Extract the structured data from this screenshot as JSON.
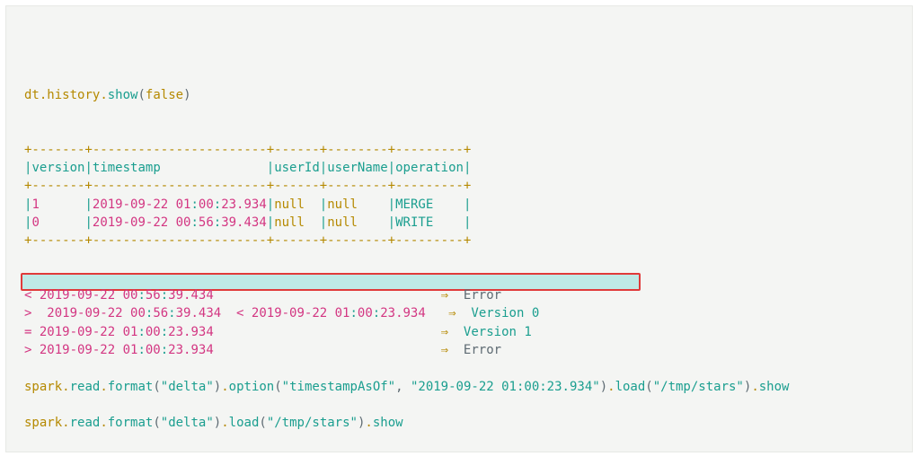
{
  "cmd1": {
    "obj": "dt",
    "d1": ".",
    "prop": "history",
    "d2": ".",
    "fn": "show",
    "lp": "(",
    "arg": "false",
    "rp": ")"
  },
  "table": {
    "rule1": "+-------+-----------------------+------+--------+---------+",
    "hdr": {
      "p0": "|",
      "c0": "version",
      "p1": "|",
      "c1": "timestamp              ",
      "p2": "|",
      "c2": "userId",
      "p3": "|",
      "c3": "userName",
      "p4": "|",
      "c4": "operation",
      "p5": "|"
    },
    "rule2": "+-------+-----------------------+------+--------+---------+",
    "row1": {
      "p0": "|",
      "v": "1      ",
      "p1": "|",
      "ts_a": "2019-09-22 01",
      "colon1": ":",
      "ts_b": "00",
      "colon2": ":",
      "ts_c": "23.934",
      "p2": "|",
      "uid": "null  ",
      "p3": "|",
      "un": "null    ",
      "p4": "|",
      "op": "MERGE    ",
      "p5": "|"
    },
    "row2": {
      "p0": "|",
      "v": "0      ",
      "p1": "|",
      "ts_a": "2019-09-22 00",
      "colon1": ":",
      "ts_b": "56",
      "colon2": ":",
      "ts_c": "39.434",
      "p2": "|",
      "uid": "null  ",
      "p3": "|",
      "un": "null    ",
      "p4": "|",
      "op": "WRITE    ",
      "p5": "|"
    },
    "rule3": "+-------+-----------------------+------+--------+---------+"
  },
  "cmp": {
    "l1": {
      "sym": "< ",
      "ts_a": "2019-09-22 00",
      "c1": ":",
      "ts_b": "56",
      "c2": ":",
      "ts_c": "39.434",
      "pad": "                              ",
      "arr": "⇒",
      "sp": "  ",
      "r": "Error"
    },
    "l2": {
      "sym": "> ",
      "sp0": " ",
      "ts_a": "2019-09-22 00",
      "c1": ":",
      "ts_b": "56",
      "c2": ":",
      "ts_c": "39.434",
      "mid": "  < ",
      "ts2a": "2019-09-22 01",
      "c3": ":",
      "ts2b": "00",
      "c4": ":",
      "ts2c": "23.934",
      "pad": "   ",
      "arr": "⇒",
      "sp": "  ",
      "r": "Version 0"
    },
    "l3": {
      "sym": "= ",
      "ts_a": "2019-09-22 01",
      "c1": ":",
      "ts_b": "00",
      "c2": ":",
      "ts_c": "23.934",
      "pad": "                              ",
      "arr": "⇒",
      "sp": "  ",
      "r": "Version 1"
    },
    "l4": {
      "sym": "> ",
      "ts_a": "2019-09-22 01",
      "c1": ":",
      "ts_b": "00",
      "c2": ":",
      "ts_c": "23.934",
      "pad": "                              ",
      "arr": "⇒",
      "sp": "  ",
      "r": "Error"
    }
  },
  "cmd2": {
    "a": "spark",
    "d1": ".",
    "b": "read",
    "d2": ".",
    "c": "format",
    "lp1": "(",
    "s1": "\"delta\"",
    "rp1": ")",
    "d3": ".",
    "e": "option",
    "lp2": "(",
    "s2": "\"timestampAsOf\"",
    "comma": ", ",
    "s3": "\"2019-09-22 01:00:23.934\"",
    "rp2": ")",
    "d4": ".",
    "f": "load",
    "lp3": "(",
    "s4": "\"/tmp/stars\"",
    "rp3": ")",
    "d5": ".",
    "g": "show"
  },
  "cmd3": {
    "a": "spark",
    "d1": ".",
    "b": "read",
    "d2": ".",
    "c": "format",
    "lp1": "(",
    "s1": "\"delta\"",
    "rp1": ")",
    "d3": ".",
    "f": "load",
    "lp3": "(",
    "s4": "\"/tmp/stars\"",
    "rp3": ")",
    "d5": ".",
    "g": "show"
  }
}
